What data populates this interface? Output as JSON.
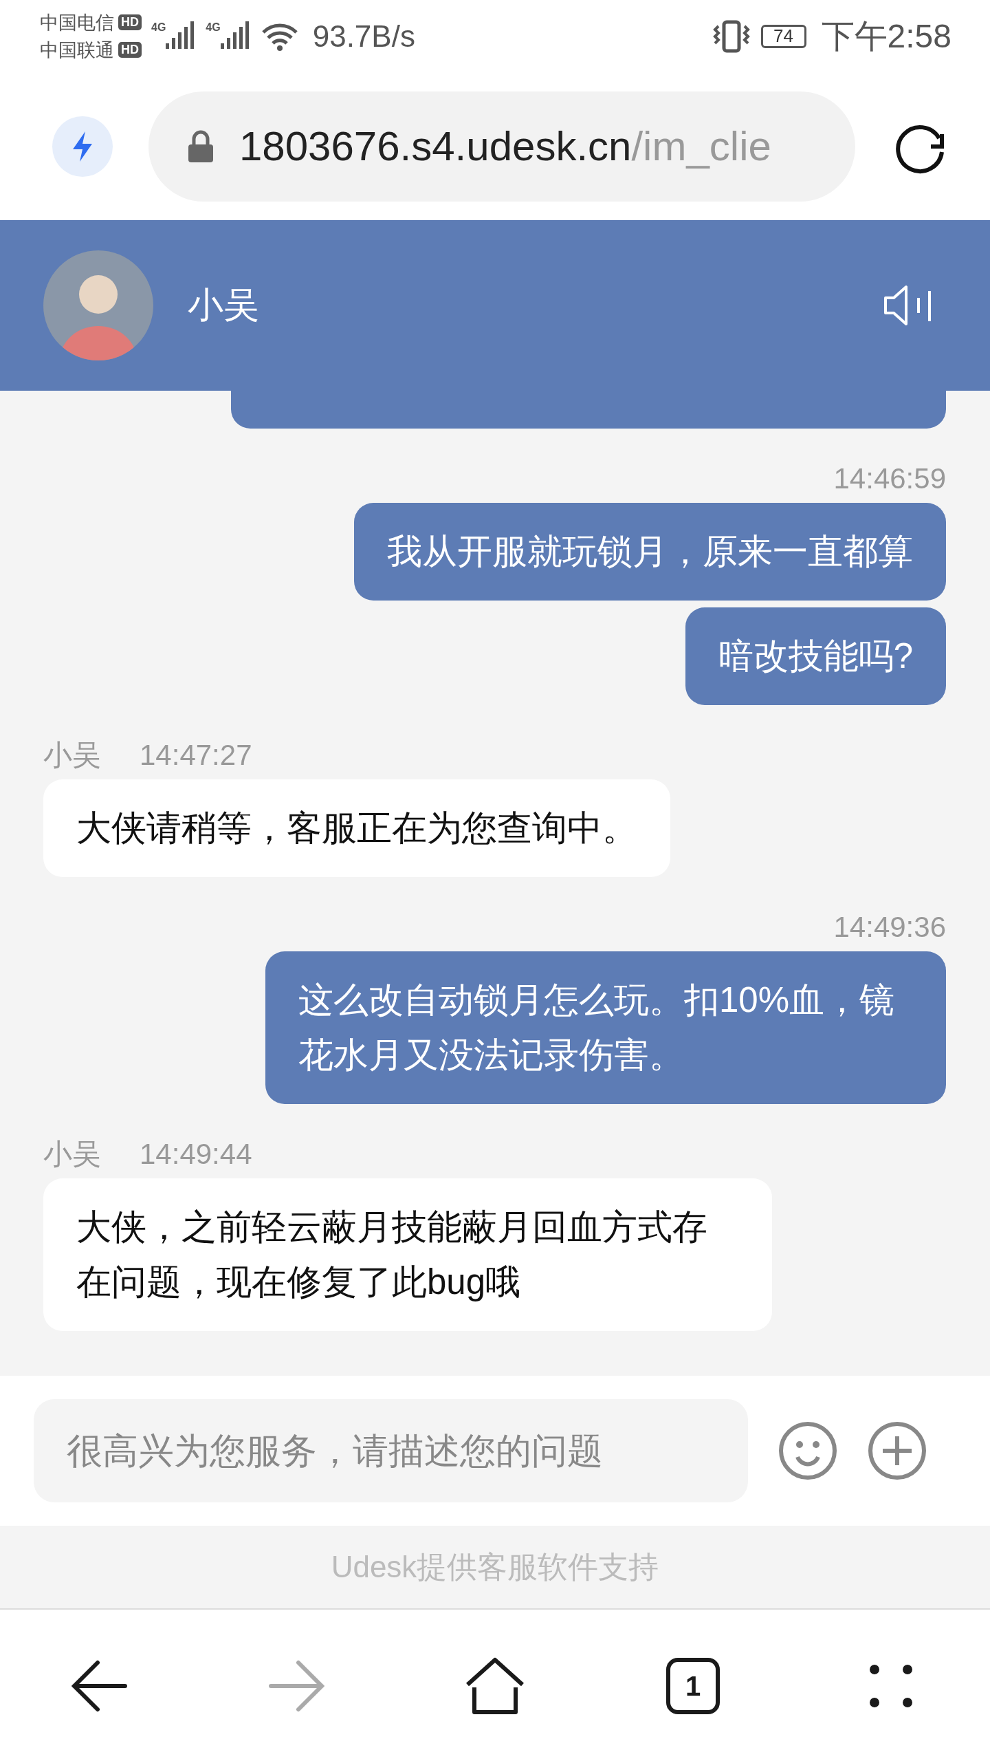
{
  "status_bar": {
    "carriers": [
      {
        "name": "中国电信",
        "badge": "HD"
      },
      {
        "name": "中国联通",
        "badge": "HD"
      }
    ],
    "networks": [
      "4G",
      "4G"
    ],
    "speed": "93.7B/s",
    "battery": "74",
    "time": "下午2:58"
  },
  "address_bar": {
    "host": "1803676.s4.udesk.cn",
    "path": "/im_clie"
  },
  "chat_header": {
    "name": "小吴"
  },
  "messages": [
    {
      "kind": "outgoing",
      "clipped": true
    },
    {
      "kind": "outgoing",
      "time": "14:46:59",
      "bubbles": [
        "我从开服就玩锁月，原来一直都算",
        "暗改技能吗?"
      ]
    },
    {
      "kind": "incoming",
      "sender": "小吴",
      "time": "14:47:27",
      "bubbles": [
        "大侠请稍等，客服正在为您查询中。"
      ]
    },
    {
      "kind": "outgoing",
      "time": "14:49:36",
      "bubbles": [
        "这么改自动锁月怎么玩。扣10%血，镜花水月又没法记录伤害。"
      ]
    },
    {
      "kind": "incoming",
      "sender": "小吴",
      "time": "14:49:44",
      "bubbles": [
        "大侠，之前轻云蔽月技能蔽月回血方式存在问题，现在修复了此bug哦"
      ]
    }
  ],
  "composer": {
    "placeholder": "很高兴为您服务，请描述您的问题"
  },
  "footer": "Udesk提供客服软件支持",
  "nav": [
    {
      "kind": "back",
      "disabled": false
    },
    {
      "kind": "forward",
      "disabled": true
    },
    {
      "kind": "home",
      "disabled": false
    },
    {
      "kind": "tabs",
      "count": "1",
      "disabled": false
    },
    {
      "kind": "menu",
      "disabled": false
    }
  ]
}
